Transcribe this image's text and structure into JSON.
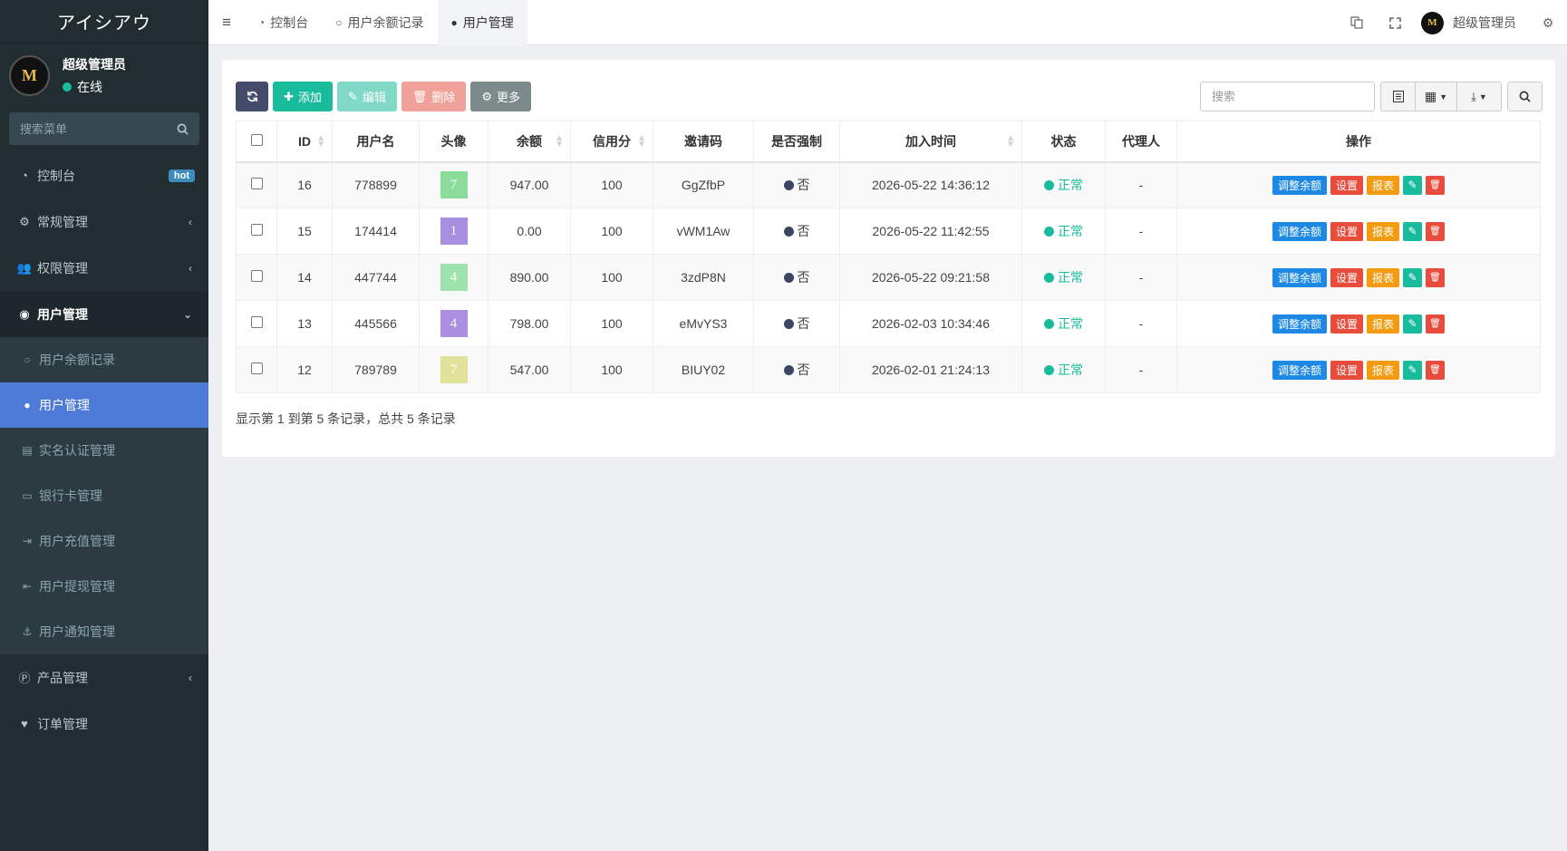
{
  "sidebar": {
    "brand": "アイシアウ",
    "avatar_text": "M",
    "user_name": "超级管理员",
    "user_status": "在线",
    "search_placeholder": "搜索菜单",
    "menu": {
      "dashboard": "控制台",
      "dashboard_badge": "hot",
      "general": "常规管理",
      "auth": "权限管理",
      "users": "用户管理",
      "products": "产品管理",
      "orders": "订单管理"
    },
    "submenu": [
      "用户余额记录",
      "用户管理",
      "实名认证管理",
      "银行卡管理",
      "用户充值管理",
      "用户提现管理",
      "用户通知管理"
    ]
  },
  "topbar": {
    "tabs": [
      "控制台",
      "用户余额记录",
      "用户管理"
    ],
    "user": "超级管理员"
  },
  "toolbar": {
    "add": "添加",
    "edit": "编辑",
    "delete": "删除",
    "more": "更多",
    "search_placeholder": "搜索"
  },
  "table": {
    "headers": [
      "ID",
      "用户名",
      "头像",
      "余额",
      "信用分",
      "邀请码",
      "是否强制",
      "加入时间",
      "状态",
      "代理人",
      "操作"
    ],
    "rows": [
      {
        "id": "16",
        "username": "778899",
        "avatar": "7",
        "avatar_color": "#8bdb9b",
        "balance": "947.00",
        "credit": "100",
        "invite": "GgZfbP",
        "force": "否",
        "joined": "2026-05-22 14:36:12",
        "status": "正常",
        "agent": "-"
      },
      {
        "id": "15",
        "username": "174414",
        "avatar": "1",
        "avatar_color": "#a790e0",
        "balance": "0.00",
        "credit": "100",
        "invite": "vWM1Aw",
        "force": "否",
        "joined": "2026-05-22 11:42:55",
        "status": "正常",
        "agent": "-"
      },
      {
        "id": "14",
        "username": "447744",
        "avatar": "4",
        "avatar_color": "#9ee3ad",
        "balance": "890.00",
        "credit": "100",
        "invite": "3zdP8N",
        "force": "否",
        "joined": "2026-05-22 09:21:58",
        "status": "正常",
        "agent": "-"
      },
      {
        "id": "13",
        "username": "445566",
        "avatar": "4",
        "avatar_color": "#ab8fe0",
        "balance": "798.00",
        "credit": "100",
        "invite": "eMvYS3",
        "force": "否",
        "joined": "2026-02-03 10:34:46",
        "status": "正常",
        "agent": "-"
      },
      {
        "id": "12",
        "username": "789789",
        "avatar": "7",
        "avatar_color": "#e2e39a",
        "balance": "547.00",
        "credit": "100",
        "invite": "BIUY02",
        "force": "否",
        "joined": "2026-02-01 21:24:13",
        "status": "正常",
        "agent": "-"
      }
    ],
    "actions": {
      "adjust": "调整余额",
      "settings": "设置",
      "report": "报表"
    }
  },
  "footer": "显示第 1 到第 5 条记录，总共 5 条记录",
  "colors": {
    "accent": "#4e7ad8",
    "success": "#18bc9c",
    "sidebar": "#222d32"
  }
}
